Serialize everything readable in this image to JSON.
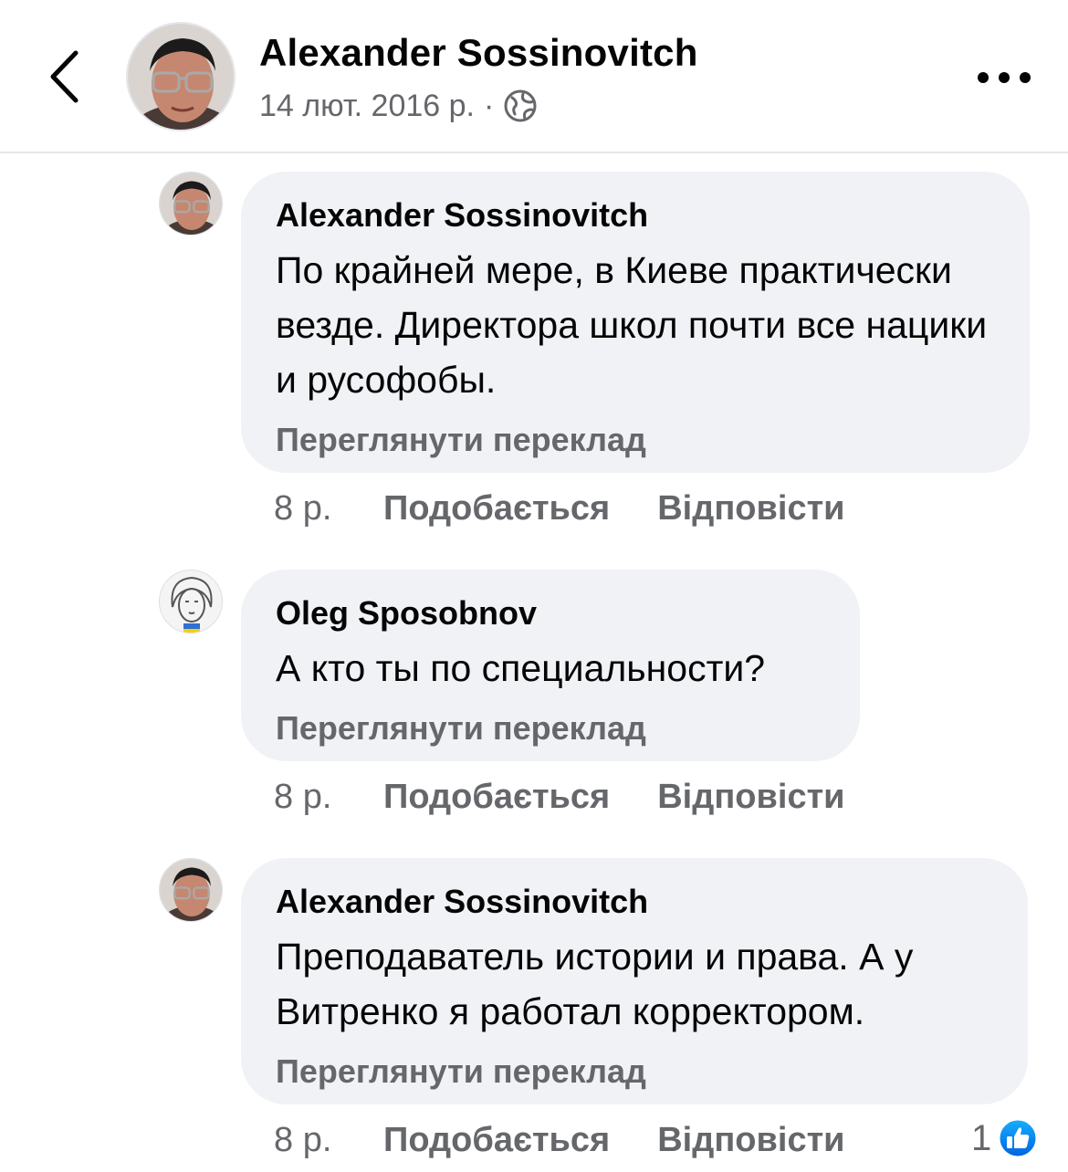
{
  "header": {
    "author": "Alexander Sossinovitch",
    "date": "14 лют. 2016 р.",
    "separator": "·",
    "privacy_icon": "globe-icon",
    "back_icon": "chevron-left-icon",
    "more_icon": "more-dots-icon"
  },
  "comments": [
    {
      "author": "Alexander Sossinovitch",
      "text": "По крайней мере, в Киеве практически везде. Директора школ почти все нацики и русофобы.",
      "translate": "Переглянути переклад",
      "time": "8 р.",
      "like": "Подобається",
      "reply": "Відповісти"
    },
    {
      "author": "Oleg Sposobnov",
      "text": "А кто ты по специальности?",
      "translate": "Переглянути переклад",
      "time": "8 р.",
      "like": "Подобається",
      "reply": "Відповісти"
    },
    {
      "author": "Alexander Sossinovitch",
      "text": "Преподаватель истории и права. А у Витренко я работал корректором.",
      "translate": "Переглянути переклад",
      "time": "8 р.",
      "like": "Подобається",
      "reply": "Відповісти",
      "reaction_count": "1",
      "reaction_icon": "thumbs-up-icon"
    }
  ],
  "colors": {
    "bubble": "#f0f2f5",
    "secondary_text": "#65676b",
    "like_blue": "#1877f2"
  }
}
